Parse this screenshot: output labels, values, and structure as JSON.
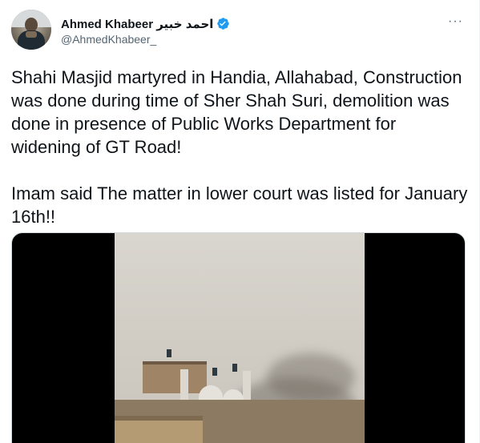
{
  "author": {
    "display_name": "Ahmed Khabeer احمد خبیر",
    "handle": "@AhmedKhabeer_",
    "verified_color": "#1d9bf0"
  },
  "tweet": {
    "paragraph1": "Shahi Masjid martyred in Handia, Allahabad, Construction was done during time of Sher Shah Suri, demolition was done in presence of Public Works Department for widening of GT Road!",
    "paragraph2": "Imam said The matter in lower court was listed for January 16th!!"
  },
  "icons": {
    "more": "more-icon",
    "verified": "verified-badge-icon",
    "more_glyph": "···"
  },
  "media": {
    "type": "video",
    "description_colors": {
      "letterbox": "#000000",
      "frame_bg": "#d2cec6"
    }
  }
}
